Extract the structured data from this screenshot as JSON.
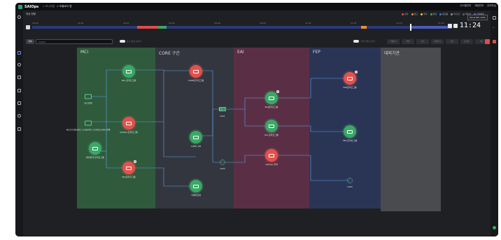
{
  "app": {
    "name": "SAIOps",
    "breadcrumbs": [
      "> 모니터링",
      "> 토폴로지 맵"
    ],
    "top_right": [
      "시스템관리",
      "계정관리",
      "관리자님"
    ]
  },
  "subheader": {
    "title": "대상 현황"
  },
  "legend": [
    {
      "label": "심각",
      "color": "#e24c4c"
    },
    {
      "label": "경고",
      "color": "#f08c2e"
    },
    {
      "label": "주의",
      "color": "#f2c94c"
    },
    {
      "label": "정상",
      "color": "#3aa866"
    },
    {
      "label": "점검중",
      "color": "#2f80ed"
    },
    {
      "label": "미수집",
      "color": "#8a8f98"
    },
    {
      "label": "비활성",
      "color": "#5a5f68"
    },
    {
      "label": "장애예측",
      "color": "#9b51e0"
    }
  ],
  "realtime": {
    "label": "REALTIME VIEW"
  },
  "clock": {
    "time": "11:24"
  },
  "timeline": {
    "ticks": [
      "10:25",
      "10:31",
      "10:37",
      "10:43",
      "10:49",
      "10:55",
      "11:01",
      "11:07",
      "11:13",
      "11:19"
    ]
  },
  "toolbar": {
    "filter_label": "전체",
    "search_placeholder": "Search",
    "toggle1_label": "표시 옵션 보이기",
    "toggle2_label": "기관 라벨 보이기",
    "buttons": [
      "전체보기",
      "확대",
      "축소",
      "되돌리기",
      "저장",
      "초기화",
      "설정"
    ]
  },
  "zones": [
    {
      "label": "MCI",
      "color": "#2f5a3c"
    },
    {
      "label": "CORE 구간",
      "color": "#33363f"
    },
    {
      "label": "EAI",
      "color": "#5a2f45"
    },
    {
      "label": "FEP",
      "color": "#2a3556"
    },
    {
      "label": "대외기관",
      "color": "#4a4b4e"
    }
  ],
  "nodes": {
    "mci_server": "MCI 온라인그룹",
    "mci_monitor1": "MCI연계",
    "mci_monitor2": "MCI/CORE/MCI CORE/MCI CORE/CORE 연계",
    "mci_batch": "SAIOps 온라인그룹",
    "mci_other": "대외연계 온라인그룹",
    "mci_red": "MCI관리자그룹",
    "core_server": "CORE온라인그룹",
    "core_switch": "GW1",
    "core_mid": "CORE_DB",
    "core_gear": "GW2",
    "core_bottom": "카메라연계",
    "eai_top": "EAI온라인그룹",
    "eai_mid": "EAI 온라인그룹",
    "eai_bottom": "SAIOps 연계",
    "fep_top": "FEP온라인그룹",
    "fep_mid": "FEP 온라인그룹",
    "fep_gear": "GW3"
  }
}
